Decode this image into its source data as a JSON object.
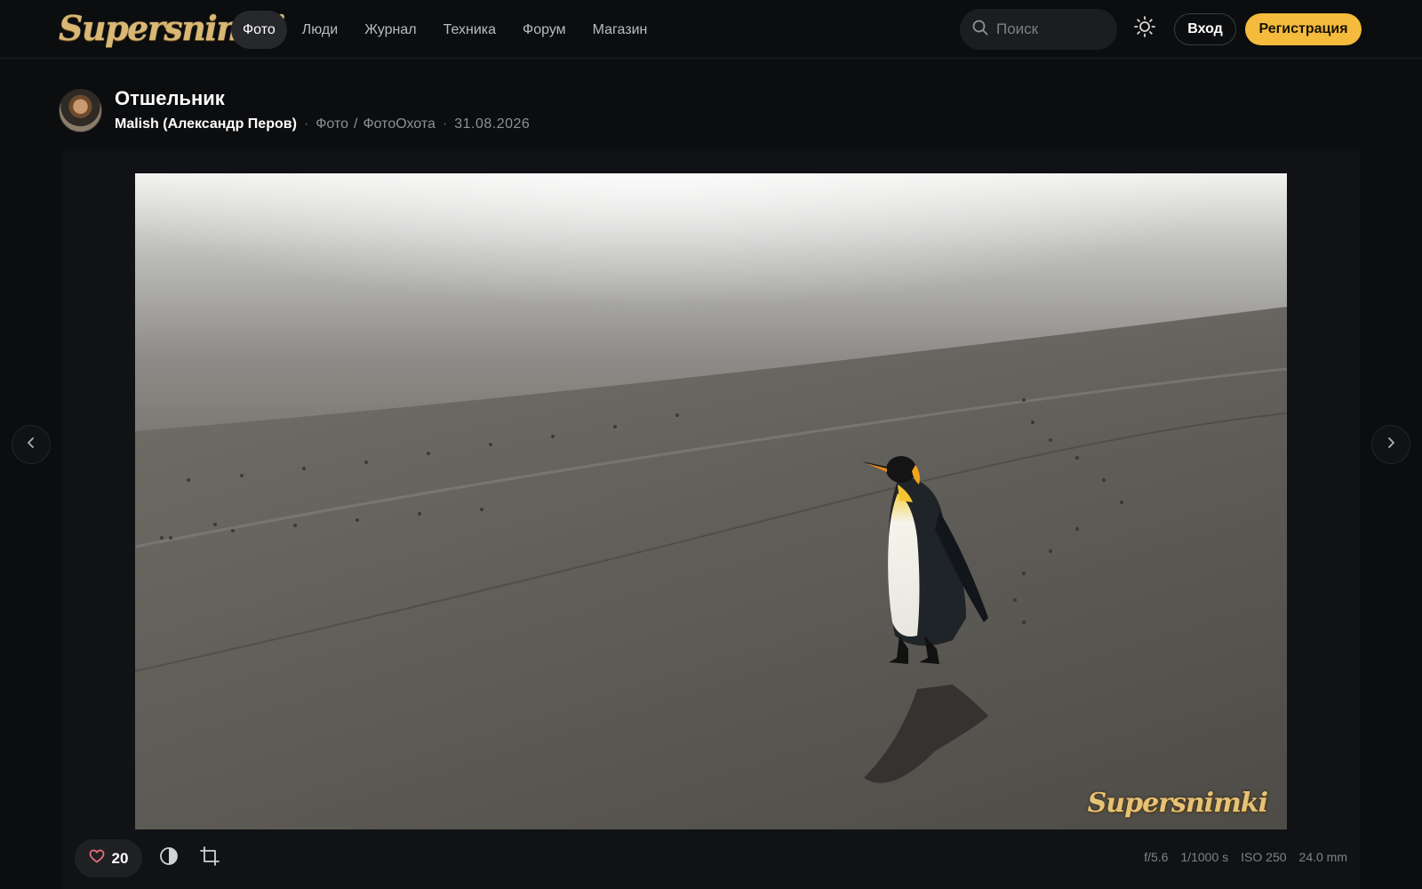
{
  "app": {
    "logo_text": "Supersnimki"
  },
  "nav": {
    "items": [
      {
        "label": "Фото",
        "active": true
      },
      {
        "label": "Люди",
        "active": false
      },
      {
        "label": "Журнал",
        "active": false
      },
      {
        "label": "Техника",
        "active": false
      },
      {
        "label": "Форум",
        "active": false
      },
      {
        "label": "Магазин",
        "active": false
      }
    ]
  },
  "search": {
    "placeholder": "Поиск",
    "value": ""
  },
  "header_actions": {
    "theme_icon": "sun-icon",
    "login_label": "Вход",
    "register_label": "Регистрация"
  },
  "photo": {
    "title": "Отшельник",
    "author": "Malish (Александр Перов)",
    "breadcrumb": [
      "Фото",
      "ФотоОхота"
    ],
    "date": "31.08.2026",
    "watermark": "Supersnimki",
    "likes": "20",
    "exif": {
      "aperture": "f/5.6",
      "shutter": "1/1000 s",
      "iso": "ISO 250",
      "focal": "24.0 mm"
    }
  },
  "icons": {
    "prev": "chevron-left-icon",
    "next": "chevron-right-icon",
    "like": "heart-icon",
    "contrast": "contrast-icon",
    "crop": "crop-icon",
    "search": "search-icon"
  },
  "colors": {
    "background": "#0c0d0f",
    "accent": "#f4bb3c",
    "like_heart": "#e9707a",
    "logo": "#d9b774"
  }
}
